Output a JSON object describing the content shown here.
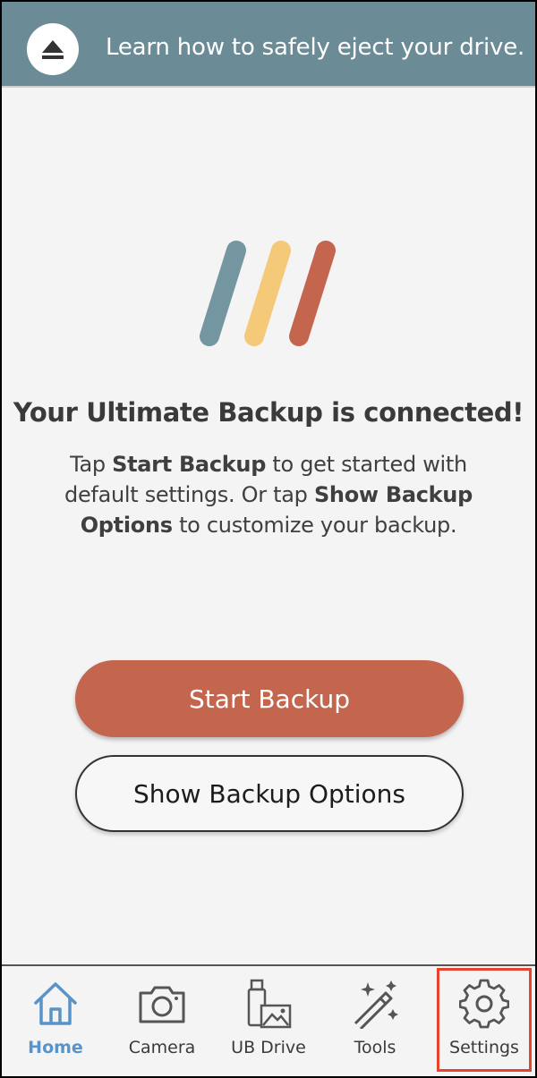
{
  "banner": {
    "text": "Learn how to safely eject your drive.",
    "icon": "eject-icon",
    "background": "#6b8c96"
  },
  "logo": {
    "colors": [
      "#7496a0",
      "#f4c977",
      "#c4654e"
    ]
  },
  "main": {
    "heading": "Your Ultimate Backup is connected!",
    "desc_part1": "Tap ",
    "desc_bold1": "Start Backup",
    "desc_part2": " to get started with default settings. Or tap ",
    "desc_bold2": "Show Backup Options",
    "desc_part3": " to customize your backup."
  },
  "buttons": {
    "start_label": "Start Backup",
    "options_label": "Show Backup Options",
    "primary_color": "#c4654e"
  },
  "nav": {
    "items": [
      {
        "label": "Home",
        "icon": "home-icon",
        "active": true
      },
      {
        "label": "Camera",
        "icon": "camera-icon",
        "active": false
      },
      {
        "label": "UB Drive",
        "icon": "usb-drive-icon",
        "active": false
      },
      {
        "label": "Tools",
        "icon": "magic-wand-icon",
        "active": false
      },
      {
        "label": "Settings",
        "icon": "gear-icon",
        "active": false
      }
    ],
    "active_color": "#5a93c8",
    "highlight_color": "#e8432f"
  }
}
